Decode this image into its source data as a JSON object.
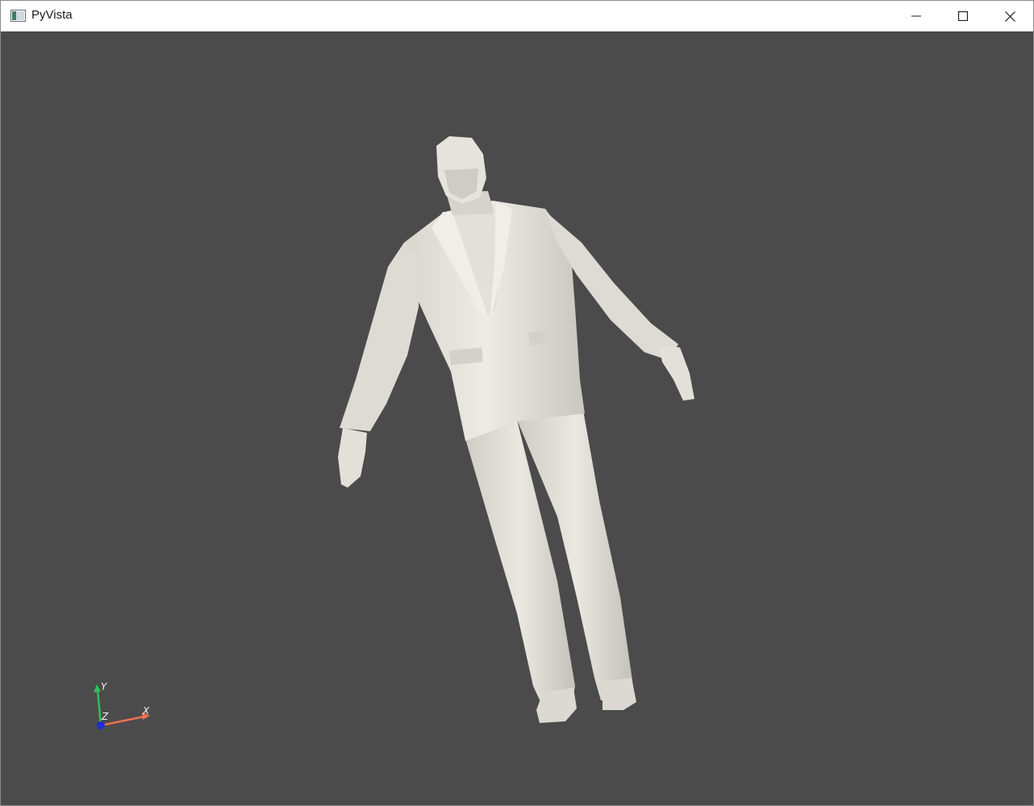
{
  "window": {
    "title": "PyVista"
  },
  "icons": {
    "app": "pyvista-app-icon",
    "minimize": "minimize-icon",
    "maximize": "maximize-icon",
    "close": "close-icon"
  },
  "viewport": {
    "background_color": "#4b4b4b",
    "mesh_color": "#e6e3dc"
  },
  "axes_widget": {
    "x_label": "X",
    "y_label": "Y",
    "z_label": "Z",
    "x_color": "#f07050",
    "y_color": "#2fbf5a",
    "z_color": "#1f2fd0"
  }
}
